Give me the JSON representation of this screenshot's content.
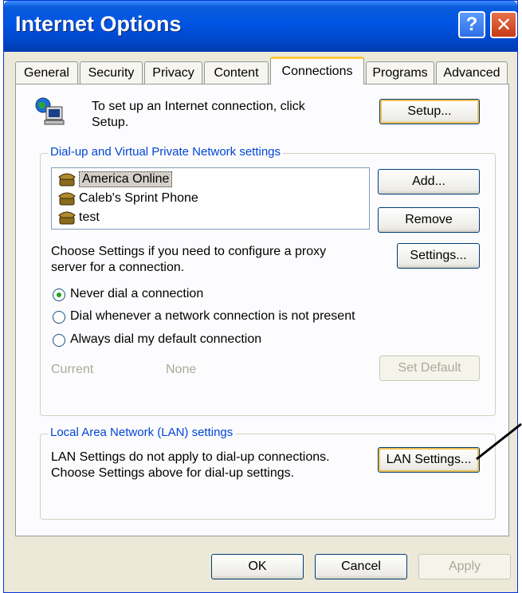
{
  "window": {
    "title": "Internet Options",
    "help": "?",
    "close": "✕"
  },
  "tabs": [
    {
      "label": "General"
    },
    {
      "label": "Security"
    },
    {
      "label": "Privacy"
    },
    {
      "label": "Content"
    },
    {
      "label": "Connections",
      "active": true
    },
    {
      "label": "Programs"
    },
    {
      "label": "Advanced"
    }
  ],
  "setup": {
    "text_line1": "To set up an Internet connection, click",
    "text_line2": "Setup.",
    "button": "Setup..."
  },
  "dialup": {
    "group_title": "Dial-up and Virtual Private Network settings",
    "connections": [
      {
        "name": "America Online"
      },
      {
        "name": "Caleb's Sprint Phone"
      },
      {
        "name": "test"
      }
    ],
    "add_button": "Add...",
    "remove_button": "Remove",
    "settings_text_line1": "Choose Settings if you need to configure a proxy",
    "settings_text_line2": "server for a connection.",
    "settings_button": "Settings...",
    "options": [
      {
        "label": "Never dial a connection",
        "selected": true
      },
      {
        "label": "Dial whenever a network connection is not present",
        "selected": false
      },
      {
        "label": "Always dial my default connection",
        "selected": false
      }
    ],
    "current_label": "Current",
    "current_value": "None",
    "set_default_button": "Set Default"
  },
  "lan": {
    "group_title": "Local Area Network (LAN) settings",
    "text_line1": "LAN Settings do not apply to dial-up connections.",
    "text_line2": "Choose Settings above for dial-up settings.",
    "button": "LAN Settings..."
  },
  "footer": {
    "ok": "OK",
    "cancel": "Cancel",
    "apply": "Apply"
  },
  "colors": {
    "titlebar": "#0054e3",
    "face": "#ece9d8",
    "group_title": "#0046d5",
    "focus_ring": "#f0c354"
  }
}
